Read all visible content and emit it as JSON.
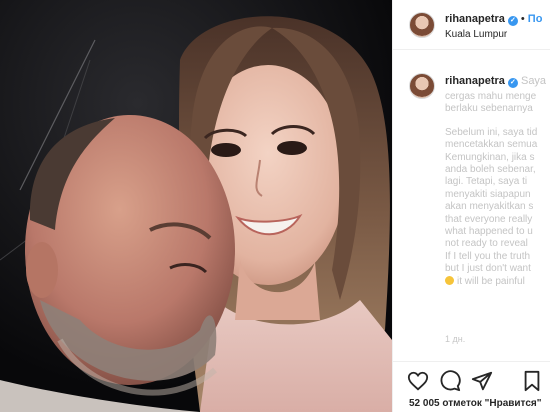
{
  "post": {
    "username": "rihanapetra",
    "follow_label": "По",
    "location": "Kuala Lumpur"
  },
  "caption": {
    "username": "rihanapetra",
    "username_suffix": " Saya",
    "lines": [
      "cergas mahu menge",
      "berlaku sebenarnya",
      "Sebelum ini, saya tid",
      "mencetakkan semua",
      "Kemungkinan, jika s",
      "anda boleh sebenar,",
      "lagi. Tetapi, saya ti",
      "menyakiti siapapun",
      "akan menyakitkan s",
      "that everyone really",
      "what happened to u",
      "not ready to reveal",
      "If I tell you the truth",
      "but I just don't want",
      "it will be painful"
    ],
    "timestamp": "1 дн."
  },
  "stats": {
    "likes_count": "52 005",
    "likes_label": "отметок",
    "likes_suffix": "\"Нравится\""
  },
  "icons": [
    "verified-badge-icon",
    "heart-icon",
    "comment-icon",
    "share-icon",
    "bookmark-icon",
    "smile-emoji-icon"
  ],
  "colors": {
    "accent": "#3897f0",
    "text": "#262626",
    "muted": "#c4c4c4",
    "border": "#efefef"
  }
}
